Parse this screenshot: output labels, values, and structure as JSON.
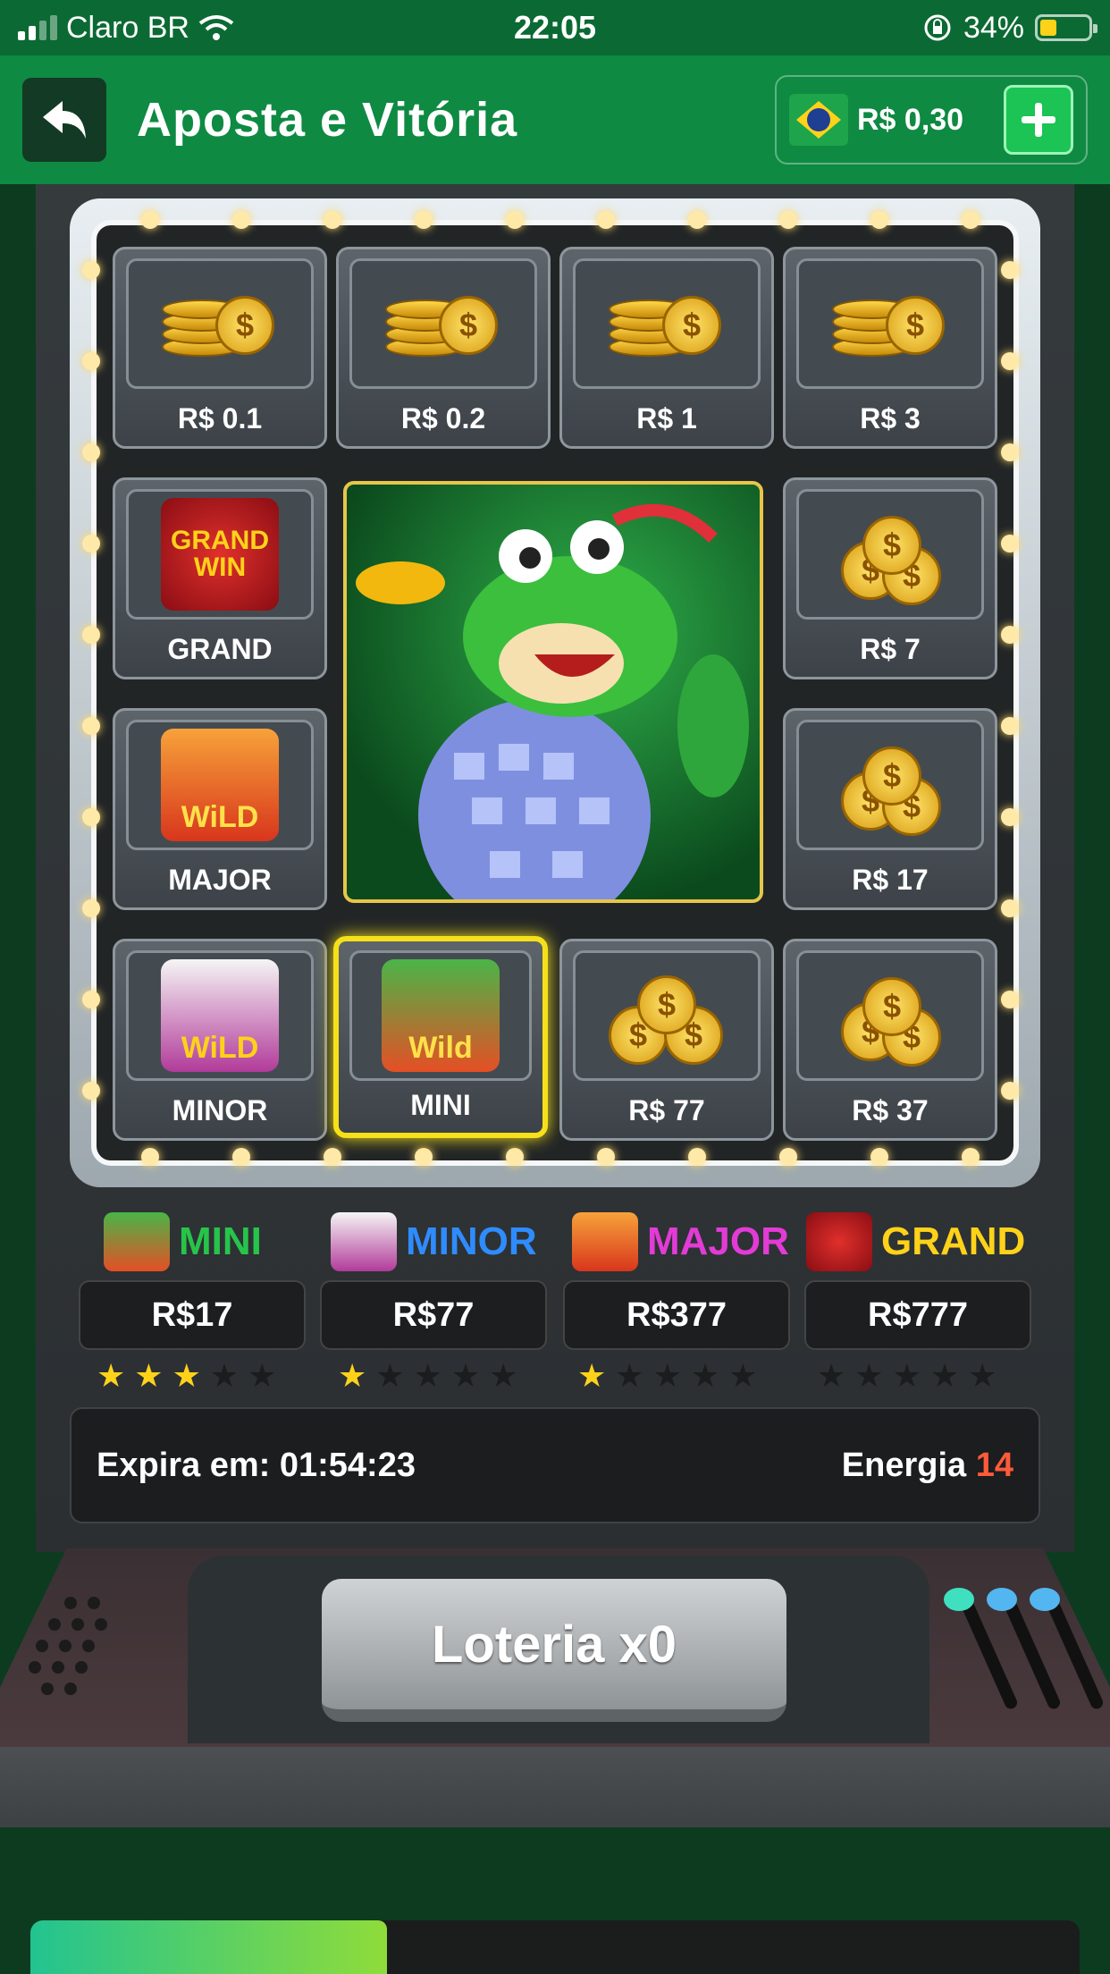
{
  "status_bar": {
    "carrier": "Claro BR",
    "time": "22:05",
    "battery": "34%"
  },
  "header": {
    "title": "Aposta e Vitória",
    "balance": "R$ 0,30"
  },
  "grid": {
    "top": [
      "R$ 0.1",
      "R$ 0.2",
      "R$ 1",
      "R$ 3"
    ],
    "grand": "GRAND",
    "major": "MAJOR",
    "r7": "R$ 7",
    "r17": "R$ 17",
    "bottom": [
      "MINOR",
      "MINI",
      "R$ 77",
      "R$ 37"
    ],
    "icon_grand": "GRAND WIN",
    "icon_wild": "WiLD",
    "icon_wild_mini": "Wild"
  },
  "jackpots": [
    {
      "name": "MINI",
      "value": "R$17",
      "stars": 3,
      "color": "#27c44a"
    },
    {
      "name": "MINOR",
      "value": "R$77",
      "stars": 1,
      "color": "#2f8cff"
    },
    {
      "name": "MAJOR",
      "value": "R$377",
      "stars": 1,
      "color": "#e23bd6"
    },
    {
      "name": "GRAND",
      "value": "R$777",
      "stars": 0,
      "color": "#ffd21a"
    }
  ],
  "info": {
    "expires_label": "Expira em: 01:54:23",
    "energy_label": "Energia",
    "energy_value": "14"
  },
  "lottery_button": "Loteria x0",
  "progress": 0.34
}
